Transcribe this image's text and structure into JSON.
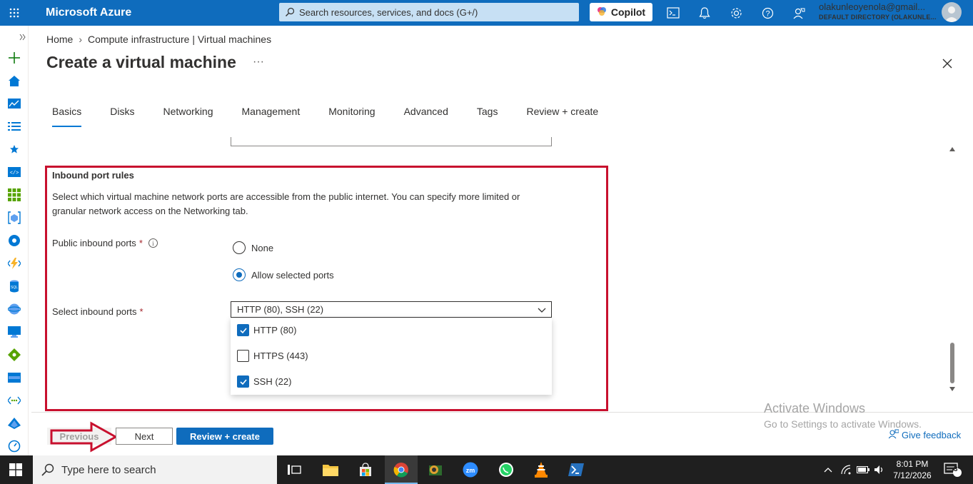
{
  "topbar": {
    "brand": "Microsoft Azure",
    "search_placeholder": "Search resources, services, and docs (G+/)",
    "copilot_label": "Copilot",
    "account_email": "olakunleoyenola@gmail...",
    "account_directory": "DEFAULT DIRECTORY (OLAKUNLE...",
    "brand_color": "#0f6cbd"
  },
  "breadcrumb": {
    "home": "Home",
    "separator": "›",
    "current": "Compute infrastructure | Virtual machines"
  },
  "page": {
    "title": "Create a virtual machine",
    "more": "···"
  },
  "tabs": [
    "Basics",
    "Disks",
    "Networking",
    "Management",
    "Monitoring",
    "Advanced",
    "Tags",
    "Review + create"
  ],
  "inbound": {
    "title": "Inbound port rules",
    "description": "Select which virtual machine network ports are accessible from the public internet. You can specify more limited or granular network access on the Networking tab.",
    "public_label": "Public inbound ports",
    "radio_none": "None",
    "radio_allow": "Allow selected ports",
    "select_label": "Select inbound ports",
    "required_mark": "*",
    "select_value": "HTTP (80), SSH (22)",
    "options": [
      {
        "label": "HTTP (80)",
        "checked": true
      },
      {
        "label": "HTTPS (443)",
        "checked": false
      },
      {
        "label": "SSH (22)",
        "checked": true
      }
    ]
  },
  "footer": {
    "previous": "Previous",
    "next": "Next",
    "review": "Review + create",
    "feedback": "Give feedback"
  },
  "watermark": {
    "line1": "Activate Windows",
    "line2": "Go to Settings to activate Windows."
  },
  "taskbar": {
    "search_placeholder": "Type here to search",
    "time": "8:01 PM",
    "date": "7/12/2026",
    "notifications": "3"
  },
  "annotation_color": "#c8102e"
}
